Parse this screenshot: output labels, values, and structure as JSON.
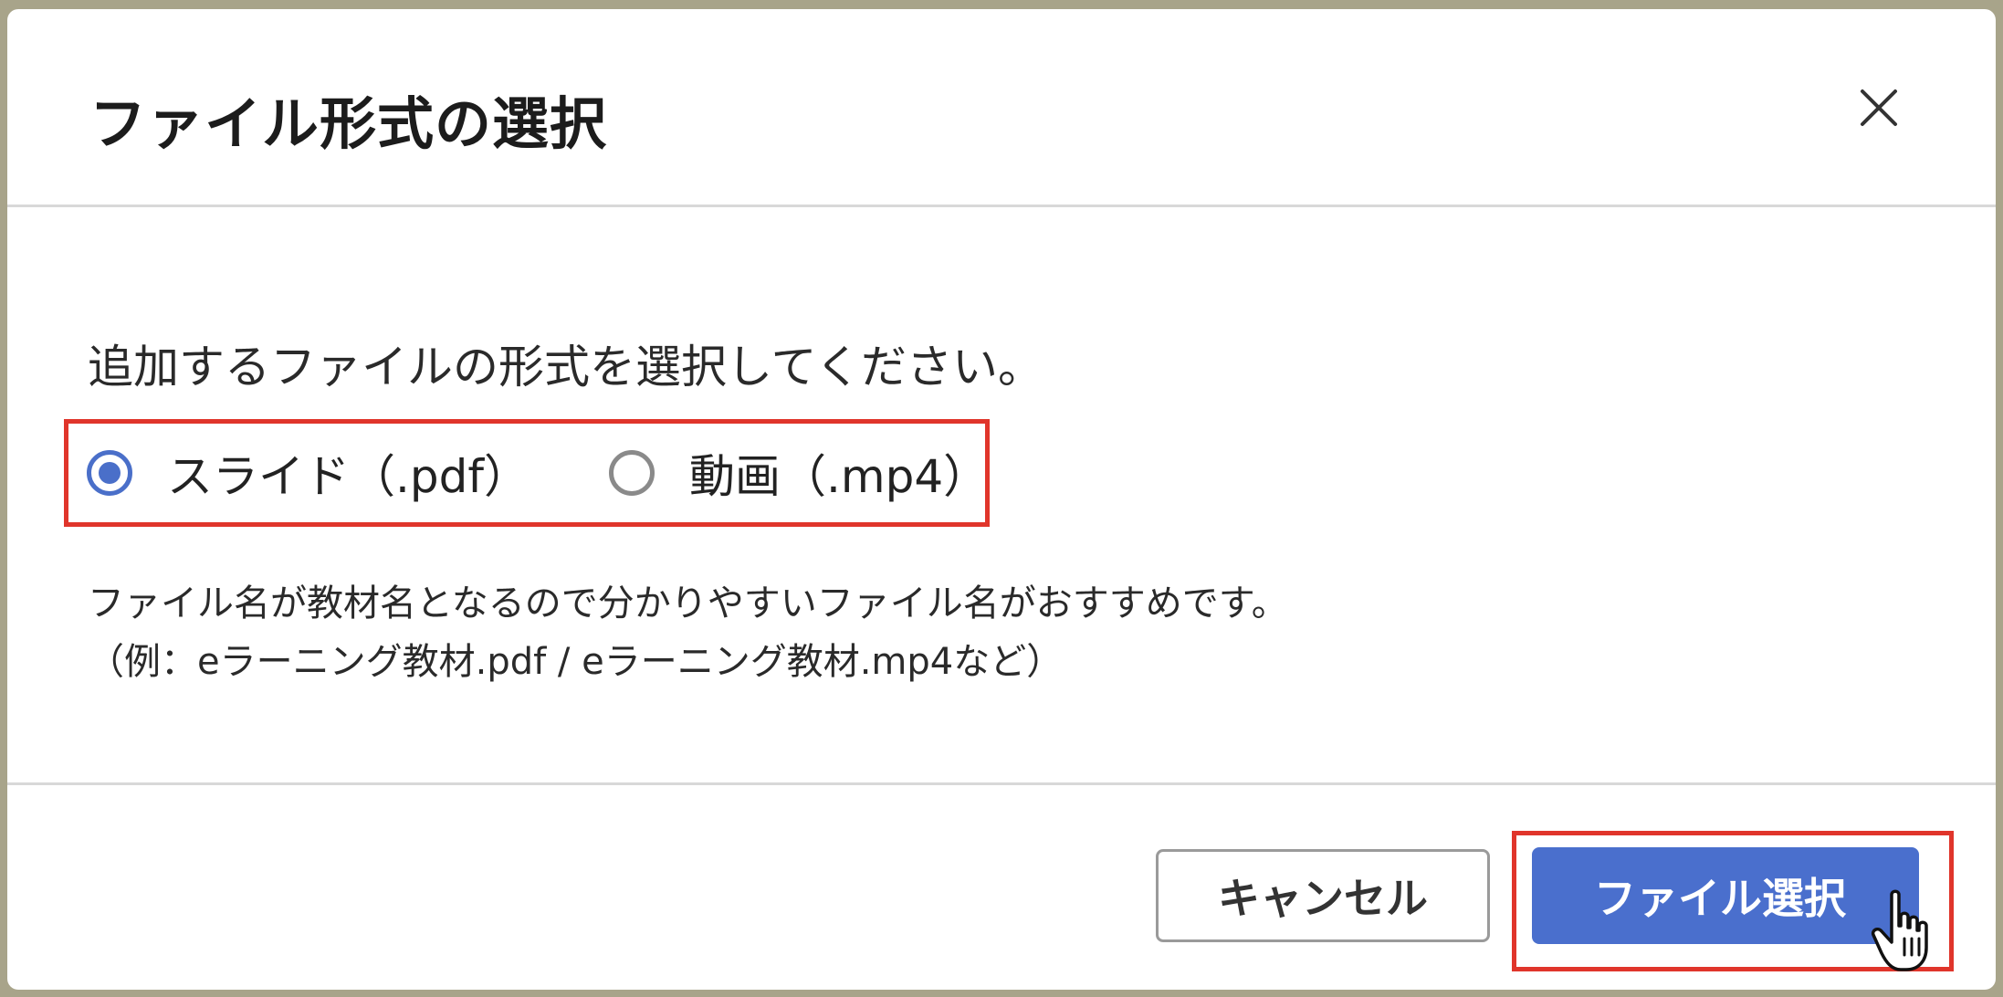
{
  "dialog": {
    "title": "ファイル形式の選択",
    "close_icon": "close-icon"
  },
  "body": {
    "instruction": "追加するファイルの形式を選択してください。",
    "options": [
      {
        "label": "スライド（.pdf）",
        "checked": true
      },
      {
        "label": "動画（.mp4）",
        "checked": false
      }
    ],
    "hint_line1": "ファイル名が教材名となるので分かりやすいファイル名がおすすめです。",
    "hint_line2": "（例：eラーニング教材.pdf / eラーニング教材.mp4など）"
  },
  "footer": {
    "cancel_label": "キャンセル",
    "select_label": "ファイル選択"
  },
  "colors": {
    "accent": "#4a6fcd",
    "highlight": "#e0352b"
  },
  "cursor_icon": "hand-pointer-icon"
}
